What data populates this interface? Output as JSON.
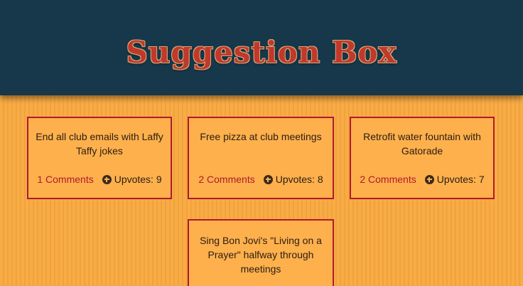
{
  "header": {
    "title": "Suggestion Box"
  },
  "colors": {
    "header_bg": "#16384a",
    "title": "#c0392b",
    "card_border": "#b0192e",
    "page_bg": "#f8ac45"
  },
  "suggestions": [
    {
      "text": "End all club emails with Laffy Taffy jokes",
      "comments_label": "1 Comments",
      "upvote_icon": "plus-circle-icon",
      "upvotes_label": "Upvotes: 9"
    },
    {
      "text": "Free pizza at club meetings",
      "comments_label": "2 Comments",
      "upvote_icon": "plus-circle-icon",
      "upvotes_label": "Upvotes: 8"
    },
    {
      "text": "Retrofit water fountain with Gatorade",
      "comments_label": "2 Comments",
      "upvote_icon": "plus-circle-icon",
      "upvotes_label": "Upvotes: 7"
    },
    {
      "text": "Sing Bon Jovi's \"Living on a Prayer\" halfway through meetings"
    }
  ]
}
